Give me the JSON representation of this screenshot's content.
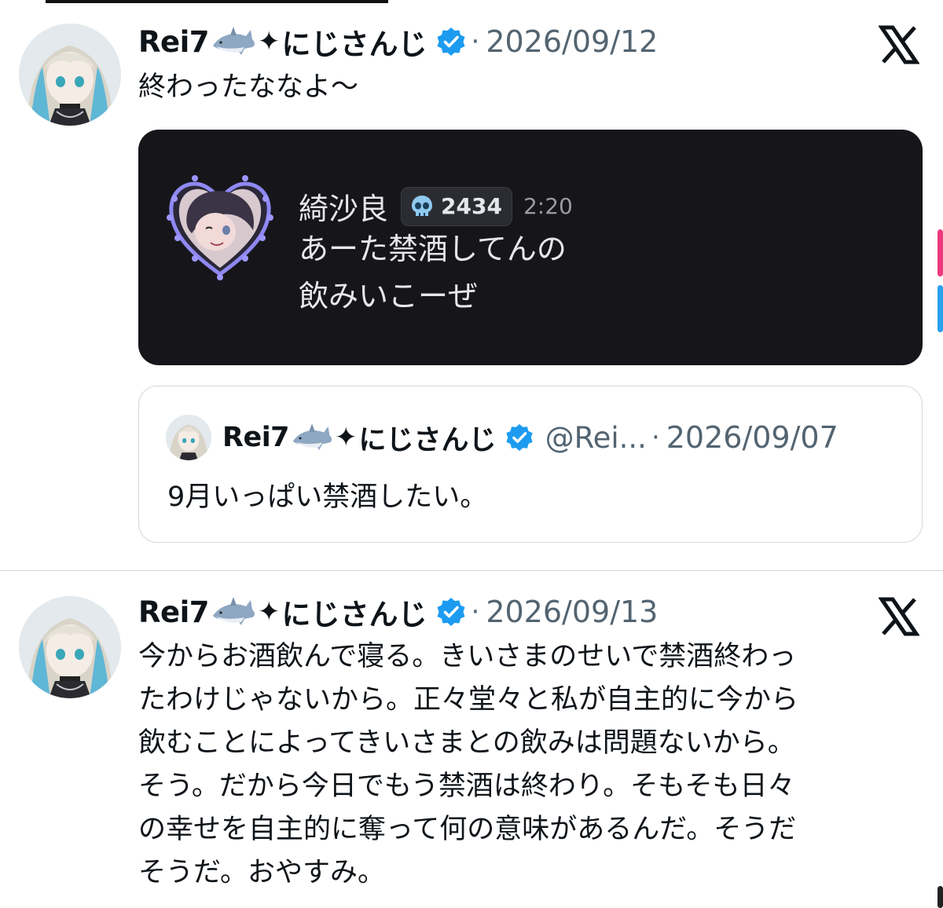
{
  "tweets": [
    {
      "author": {
        "name": "Rei7",
        "emoji": "shark-emoji",
        "sparkle": "✦",
        "name_suffix": "にじさんじ",
        "verified": true
      },
      "separator": "·",
      "date": "2026/09/12",
      "text": "終わったななよ〜",
      "attachment": {
        "type": "discord-message",
        "username": "綺沙良",
        "badge_icon": "skull-icon",
        "badge_count": "2434",
        "time": "2:20",
        "message_lines": [
          "あーた禁酒してんの",
          "飲みいこーぜ"
        ]
      },
      "quote": {
        "author": {
          "name": "Rei7",
          "emoji": "shark-emoji",
          "sparkle": "✦",
          "name_suffix": "にじさんじ",
          "verified": true
        },
        "handle": "@Rei...",
        "separator": "·",
        "date": "2026/09/07",
        "text": "9月いっぱい禁酒したい。"
      }
    },
    {
      "author": {
        "name": "Rei7",
        "emoji": "shark-emoji",
        "sparkle": "✦",
        "name_suffix": "にじさんじ",
        "verified": true
      },
      "separator": "·",
      "date": "2026/09/13",
      "text_lines": [
        "今からお酒飲んで寝る。きいさまのせいで禁酒終わっ",
        "たわけじゃないから。正々堂々と私が自主的に今から",
        "飲むことによってきいさまとの飲みは問題ないから。",
        "そう。だから今日でもう禁酒は終わり。そもそも日々",
        "の幸せを自主的に奪って何の意味があるんだ。そうだ",
        "そうだ。おやすみ。"
      ]
    }
  ],
  "brand_icon": "x-logo-icon",
  "colors": {
    "verified": "#1d9bf0",
    "muted_text": "#536471",
    "card_bg": "#16161a",
    "edge_pink": "#f0397f",
    "edge_blue": "#2aa0ee"
  }
}
